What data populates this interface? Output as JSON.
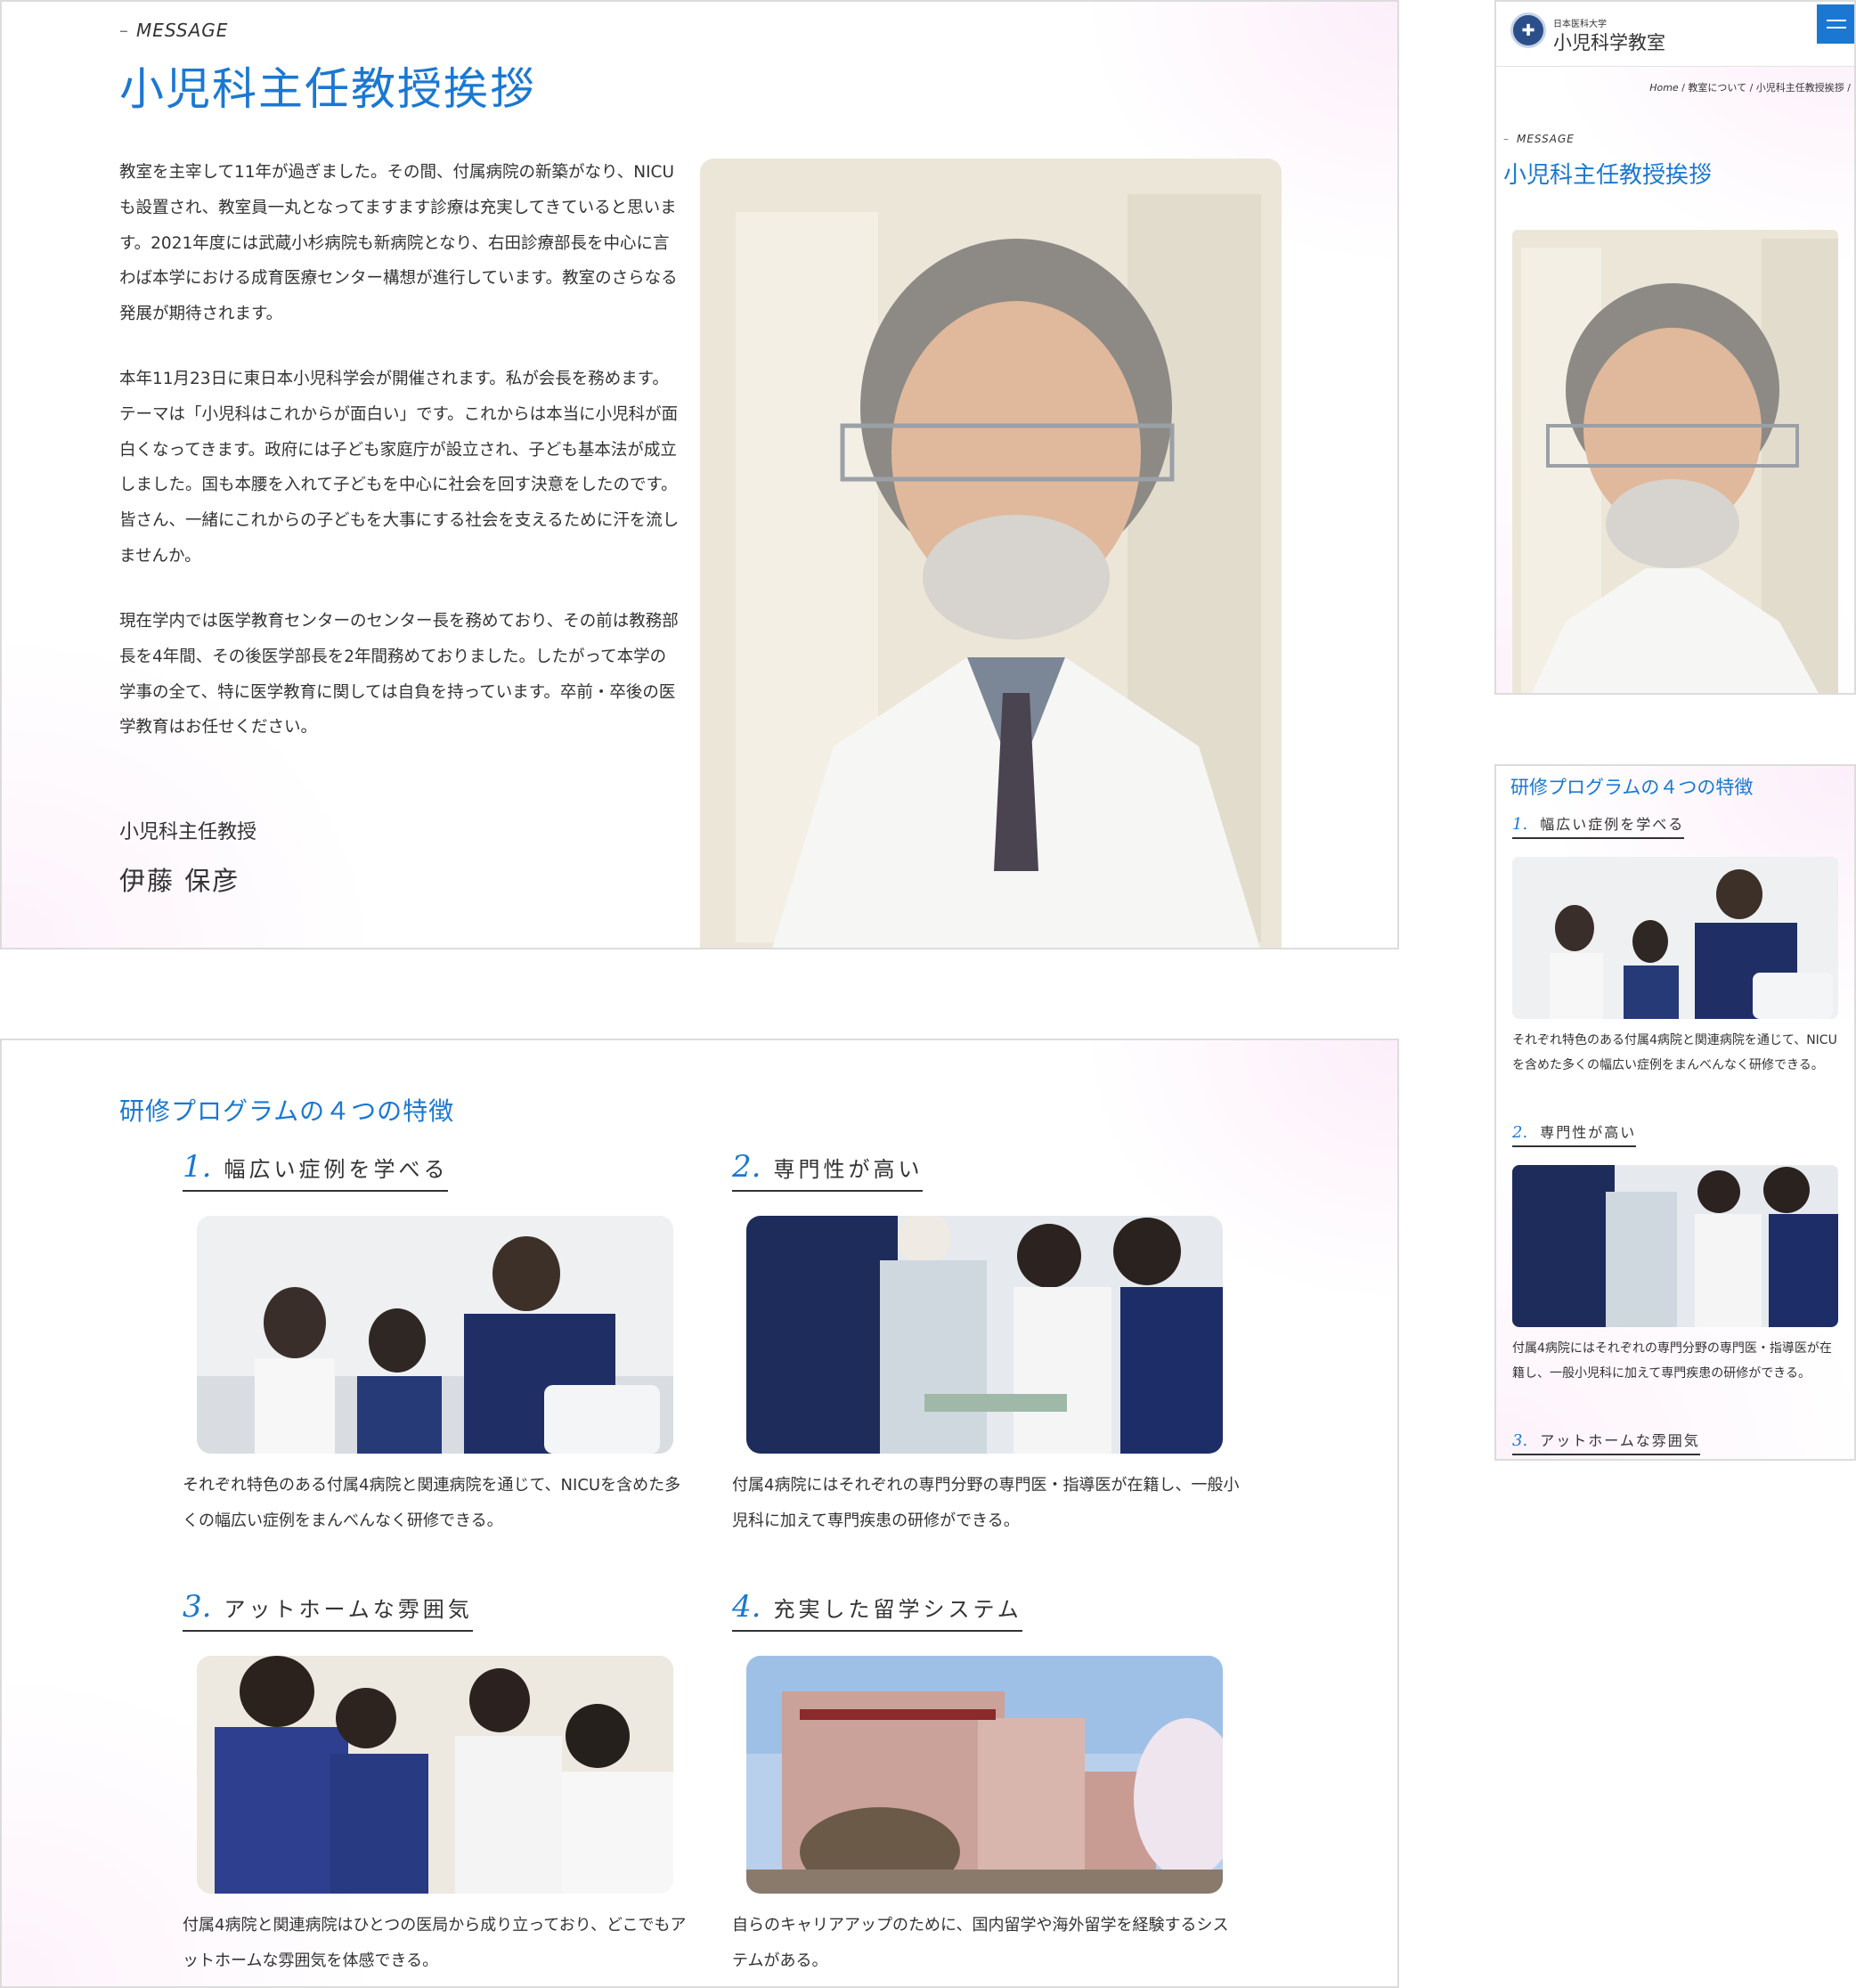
{
  "message": {
    "eyebrow": "MESSAGE",
    "title": "小児科主任教授挨拶",
    "paragraphs": [
      "教室を主宰して11年が過ぎました。その間、付属病院の新築がなり、NICUも設置され、教室員一丸となってますます診療は充実してきていると思います。2021年度には武蔵小杉病院も新病院となり、右田診療部長を中心に言わば本学における成育医療センター構想が進行しています。教室のさらなる発展が期待されます。",
      "本年11月23日に東日本小児科学会が開催されます。私が会長を務めます。テーマは「小児科はこれからが面白い」です。これからは本当に小児科が面白くなってきます。政府には子ども家庭庁が設立され、子ども基本法が成立しました。国も本腰を入れて子どもを中心に社会を回す決意をしたのです。皆さん、一緒にこれからの子どもを大事にする社会を支えるために汗を流しませんか。",
      "現在学内では医学教育センターのセンター長を務めており、その前は教務部長を4年間、その後医学部長を2年間務めておりました。したがって本学の学事の全て、特に医学教育に関しては自負を持っています。卒前・卒後の医学教育はお任せください。"
    ],
    "position": "小児科主任教授",
    "name": "伊藤 保彦"
  },
  "features": {
    "title": "研修プログラムの４つの特徴",
    "items": [
      {
        "num": "1.",
        "title": "幅広い症例を学べる",
        "desc": "それぞれ特色のある付属4病院と関連病院を通じて、NICUを含めた多くの幅広い症例をまんべんなく研修できる。"
      },
      {
        "num": "2.",
        "title": "専門性が高い",
        "desc": "付属4病院にはそれぞれの専門分野の専門医・指導医が在籍し、一般小児科に加えて専門疾患の研修ができる。"
      },
      {
        "num": "3.",
        "title": "アットホームな雰囲気",
        "desc": "付属4病院と関連病院はひとつの医局から成り立っており、どこでもアットホームな雰囲気を体感できる。"
      },
      {
        "num": "4.",
        "title": "充実した留学システム",
        "desc": "自らのキャリアアップのために、国内留学や海外留学を経験するシステムがある。"
      }
    ]
  },
  "mobile": {
    "university": "日本医科大学",
    "department": "小児科学教室",
    "breadcrumb": [
      "Home",
      "教室について",
      "小児科主任教授挨拶"
    ],
    "features_title": "研修プログラムの４つの特徴",
    "feature_items": [
      {
        "num": "1.",
        "title": "幅広い症例を学べる",
        "desc": "それぞれ特色のある付属4病院と関連病院を通じて、NICUを含めた多くの幅広い症例をまんべんなく研修できる。"
      },
      {
        "num": "2.",
        "title": "専門性が高い",
        "desc": "付属4病院にはそれぞれの専門分野の専門医・指導医が在籍し、一般小児科に加えて専門疾患の研修ができる。"
      },
      {
        "num": "3.",
        "title": "アットホームな雰囲気"
      }
    ]
  },
  "colors": {
    "accent": "#1a78d2",
    "text": "#333333",
    "border": "#dcdcdc"
  },
  "icons": [
    "menu-icon",
    "university-logo-icon"
  ]
}
